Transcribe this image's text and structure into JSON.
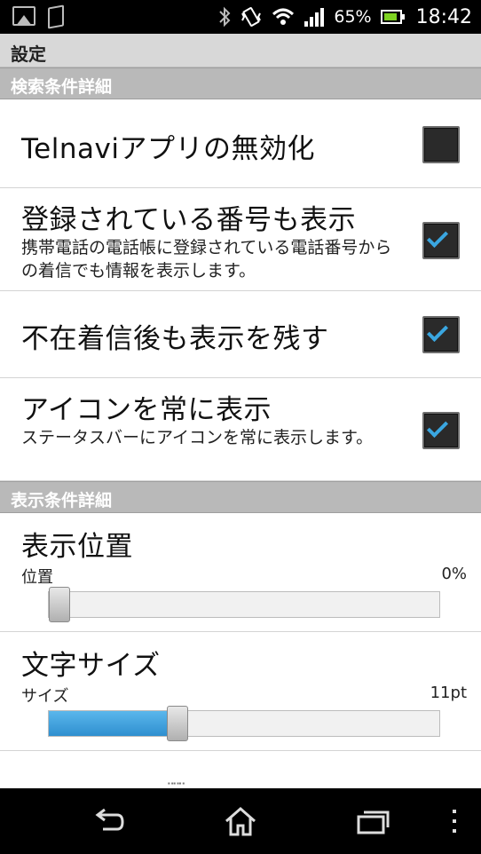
{
  "statusbar": {
    "battery_percent": "65%",
    "time": "18:42",
    "icons": [
      "gallery-icon",
      "phone-icon",
      "bluetooth-icon",
      "vibrate-icon",
      "wifi-icon",
      "signal-icon",
      "battery-icon"
    ]
  },
  "titlebar": {
    "title": "設定"
  },
  "sections": {
    "search": {
      "header": "検索条件詳細"
    },
    "display": {
      "header": "表示条件詳細"
    }
  },
  "prefs": {
    "disable_app": {
      "title": "Telnaviアプリの無効化",
      "checked": false
    },
    "show_registered": {
      "title": "登録されている番号も表示",
      "summary": "携帯電話の電話帳に登録されている電話番号からの着信でも情報を表示します。",
      "checked": true
    },
    "keep_after_missed": {
      "title": "不在着信後も表示を残す",
      "checked": true
    },
    "always_show_icon": {
      "title": "アイコンを常に表示",
      "summary": "ステータスバーにアイコンを常に表示します。",
      "checked": true
    }
  },
  "sliders": {
    "position": {
      "title": "表示位置",
      "label": "位置",
      "value_text": "0%",
      "fraction": 0.0
    },
    "font_size": {
      "title": "文字サイズ",
      "label": "サイズ",
      "value_text": "11pt",
      "fraction": 0.32
    }
  },
  "navbar": {
    "icons": [
      "back-icon",
      "home-icon",
      "recent-apps-icon",
      "menu-icon"
    ]
  },
  "colors": {
    "accent": "#3aa6e0",
    "section_header": "#b9b9b9",
    "titlebar": "#d8d8d8"
  }
}
